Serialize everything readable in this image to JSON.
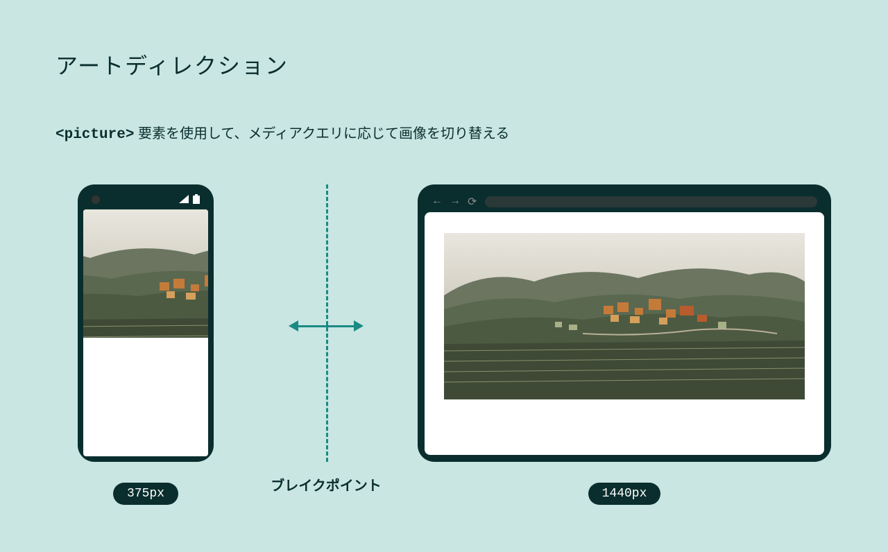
{
  "title": "アートディレクション",
  "subtitle_code": "<picture>",
  "subtitle_text": " 要素を使用して、メディアクエリに応じて画像を切り替える",
  "mobile": {
    "width_label": "375px"
  },
  "breakpoint": {
    "label": "ブレイクポイント"
  },
  "desktop": {
    "width_label": "1440px"
  }
}
